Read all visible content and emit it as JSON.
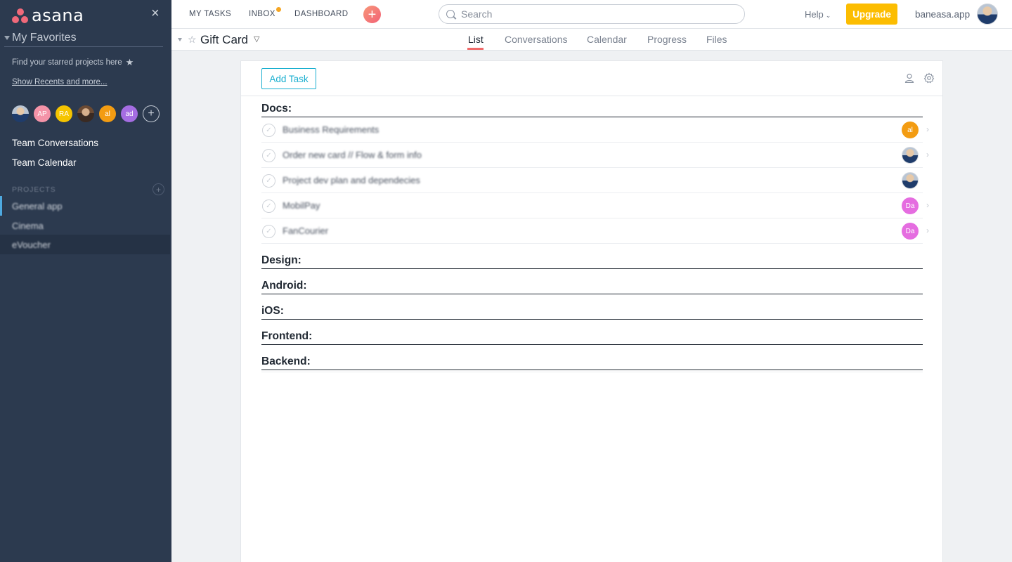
{
  "sidebar": {
    "logo_text": "asana",
    "close_icon": "×",
    "favorites_title": "My Favorites",
    "favorites_hint": "Find your starred projects here",
    "recents_link": "Show Recents and more...",
    "team_avatars": [
      {
        "initials": "",
        "color": "photo"
      },
      {
        "initials": "AP",
        "color": "#f493a8"
      },
      {
        "initials": "RA",
        "color": "#f5c400"
      },
      {
        "initials": "",
        "color": "photo"
      },
      {
        "initials": "al",
        "color": "#f39c12"
      },
      {
        "initials": "ad",
        "color": "#a56de2"
      }
    ],
    "team_conversations": "Team Conversations",
    "team_calendar": "Team Calendar",
    "projects_label": "PROJECTS",
    "projects": [
      "General app",
      "Cinema",
      "eVoucher"
    ]
  },
  "topbar": {
    "my_tasks": "MY TASKS",
    "inbox": "INBOX",
    "dashboard": "DASHBOARD",
    "search_placeholder": "Search",
    "help": "Help",
    "upgrade": "Upgrade",
    "username": "baneasa.app"
  },
  "project": {
    "title": "Gift Card",
    "tabs": [
      "List",
      "Conversations",
      "Calendar",
      "Progress",
      "Files"
    ],
    "active_tab": "List"
  },
  "panel": {
    "add_task": "Add Task",
    "sections": [
      {
        "name": "Docs:",
        "tasks": [
          {
            "name": "Business Requirements",
            "assignee": "al",
            "assignee_color": "#f39c12"
          },
          {
            "name": "Order new card // Flow & form info",
            "assignee": "",
            "assignee_color": "photo"
          },
          {
            "name": "Project dev plan and dependecies",
            "assignee": "",
            "assignee_color": "photo"
          },
          {
            "name": "MobilPay",
            "assignee": "Da",
            "assignee_color": "#e56de0"
          },
          {
            "name": "FanCourier",
            "assignee": "Da",
            "assignee_color": "#e56de0"
          }
        ]
      },
      {
        "name": "Design:",
        "tasks": []
      },
      {
        "name": "Android:",
        "tasks": []
      },
      {
        "name": "iOS:",
        "tasks": []
      },
      {
        "name": "Frontend:",
        "tasks": []
      },
      {
        "name": "Backend:",
        "tasks": []
      }
    ]
  }
}
